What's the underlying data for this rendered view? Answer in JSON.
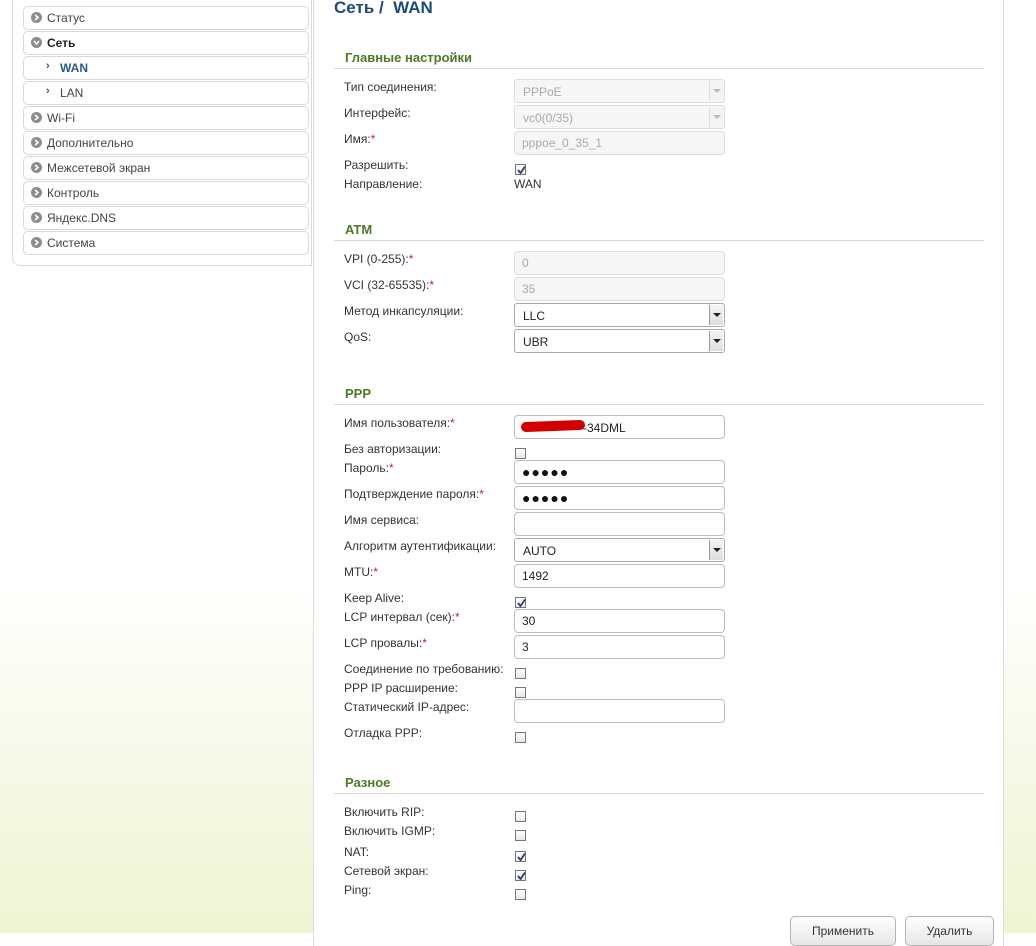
{
  "sidebar": {
    "items": [
      {
        "label": "Статус"
      },
      {
        "label": "Сеть"
      },
      {
        "label": "WAN"
      },
      {
        "label": "LAN"
      },
      {
        "label": "Wi-Fi"
      },
      {
        "label": "Дополнительно"
      },
      {
        "label": "Межсетевой экран"
      },
      {
        "label": "Контроль"
      },
      {
        "label": "Яндекс.DNS"
      },
      {
        "label": "Система"
      }
    ]
  },
  "page": {
    "title": "Сеть /  WAN"
  },
  "main_settings": {
    "title": "Главные настройки",
    "conn_type_label": "Тип соединения:",
    "conn_type_value": "PPPoE",
    "interface_label": "Интерфейс:",
    "interface_value": "vc0(0/35)",
    "name_label": "Имя:",
    "name_value": "pppoe_0_35_1",
    "enable_label": "Разрешить:",
    "direction_label": "Направление:",
    "direction_value": "WAN"
  },
  "atm": {
    "title": "ATM",
    "vpi_label": "VPI (0-255):",
    "vpi_value": "0",
    "vci_label": "VCI (32-65535):",
    "vci_value": "35",
    "encap_label": "Метод инкапсуляции:",
    "encap_value": "LLC",
    "qos_label": "QoS:",
    "qos_value": "UBR"
  },
  "ppp": {
    "title": "PPP",
    "username_label": "Имя пользователя:",
    "username_suffix": "-34DML",
    "no_auth_label": "Без авторизации:",
    "password_label": "Пароль:",
    "password_value": "●●●●●",
    "password_confirm_label": "Подтверждение пароля:",
    "password_confirm_value": "●●●●●",
    "service_label": "Имя сервиса:",
    "service_value": "",
    "auth_algo_label": "Алгоритм аутентификации:",
    "auth_algo_value": "AUTO",
    "mtu_label": "MTU:",
    "mtu_value": "1492",
    "keepalive_label": "Keep Alive:",
    "lcp_interval_label": "LCP интервал (сек):",
    "lcp_interval_value": "30",
    "lcp_fails_label": "LCP провалы:",
    "lcp_fails_value": "3",
    "on_demand_label": "Соединение по требованию:",
    "ppp_ip_ext_label": "PPP IP расширение:",
    "static_ip_label": "Статический IP-адрес:",
    "static_ip_value": "",
    "ppp_debug_label": "Отладка PPP:"
  },
  "misc": {
    "title": "Разное",
    "rip_label": "Включить RIP:",
    "igmp_label": "Включить IGMP:",
    "nat_label": "NAT:",
    "firewall_label": "Сетевой экран:",
    "ping_label": "Ping:"
  },
  "actions": {
    "apply_label": "Применить",
    "delete_label": "Удалить"
  },
  "checkboxes": {
    "enable": true,
    "no_auth": false,
    "keepalive": true,
    "on_demand": false,
    "ppp_ip_ext": false,
    "ppp_debug": false,
    "rip": false,
    "igmp": false,
    "nat": true,
    "firewall": true,
    "ping": false
  },
  "colors": {
    "section_title": "#4d7a26",
    "page_title": "#1d4a78",
    "required_mark": "#d42020",
    "active_nav": "#2a5a8a"
  }
}
